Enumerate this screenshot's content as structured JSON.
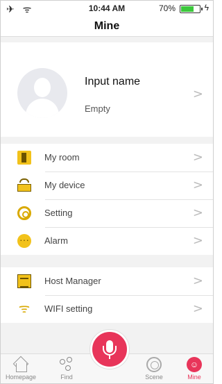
{
  "status_bar": {
    "left_icons": "✈ ᯤ",
    "time": "10:44 AM",
    "battery_percent": "70%",
    "battery_level": 0.7,
    "charging_symbol": "ϟ"
  },
  "header": {
    "title": "Mine"
  },
  "profile": {
    "name": "Input name",
    "subtitle": "Empty",
    "chevron": ">"
  },
  "menu_group_1": [
    {
      "icon": "door-icon",
      "label": "My room",
      "chevron": ">"
    },
    {
      "icon": "device-icon",
      "label": "My device",
      "chevron": ">"
    },
    {
      "icon": "gear-icon",
      "label": "Setting",
      "chevron": ">"
    },
    {
      "icon": "chat-bubble-icon",
      "label": "Alarm",
      "chevron": ">"
    }
  ],
  "menu_group_2": [
    {
      "icon": "host-icon",
      "label": "Host Manager",
      "chevron": ">"
    },
    {
      "icon": "wifi-icon",
      "label": "WIFI setting",
      "chevron": ">",
      "glyph": "ᯤ"
    }
  ],
  "tabbar": {
    "items": [
      {
        "icon": "home-icon",
        "label": "Homepage"
      },
      {
        "icon": "find-icon",
        "label": "Find"
      },
      {
        "icon": "scene-icon",
        "label": "Scene"
      },
      {
        "icon": "mine-face-icon",
        "label": "Mine",
        "glyph": "☺"
      }
    ],
    "active": "Mine",
    "accent_color": "#e8355a"
  },
  "colors": {
    "icon_yellow": "#f2c21b",
    "accent": "#e8355a"
  }
}
